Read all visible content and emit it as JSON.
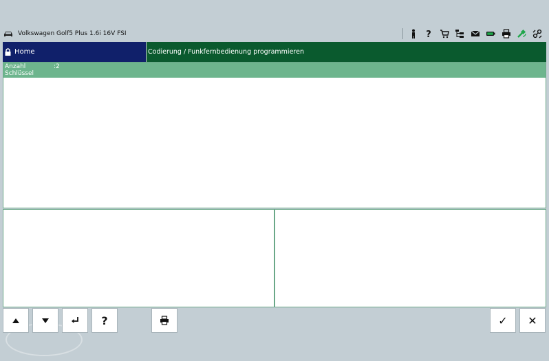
{
  "vehicle": {
    "name": "Volkswagen Golf5 Plus 1.6i 16V FSI",
    "icon": "car-icon"
  },
  "toolbar": {
    "icons": [
      "person-icon",
      "help-icon",
      "cart-icon",
      "tree-icon",
      "mail-icon",
      "battery-icon",
      "printer-icon",
      "connection-icon",
      "network-icon"
    ]
  },
  "nav": {
    "home_label": "Home",
    "title": "Codierung / Funkfernbedienung programmieren"
  },
  "main": {
    "field_label_line1": "Anzahl",
    "field_label_line2": "Schlüssel",
    "field_value": ":2"
  },
  "bottom": {
    "up": "▲",
    "down": "▼",
    "enter": "↵",
    "help": "?",
    "confirm": "✓",
    "cancel": "✕"
  },
  "colors": {
    "home_bg": "#10206a",
    "title_bg": "#0a5a2e",
    "header_bg": "#6db58d",
    "background": "#c3ced4"
  }
}
